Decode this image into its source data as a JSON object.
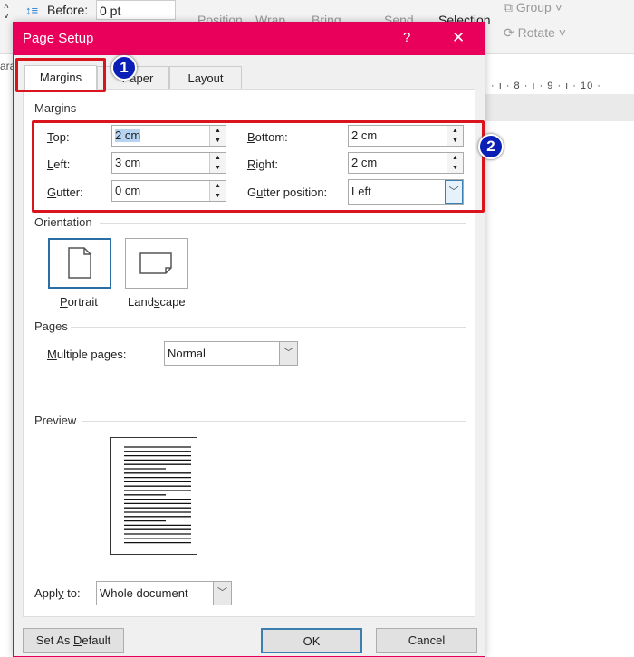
{
  "ribbon": {
    "before_label": "Before:",
    "before_value": "0 pt",
    "items": [
      "Position",
      "Wrap",
      "Bring",
      "Send",
      "Selection",
      "Group",
      "Rotate"
    ],
    "partial_label": "ara"
  },
  "ruler": {
    "ticks": "· ı · 8 · ı · 9 · ı · 10 ·"
  },
  "dialog": {
    "title": "Page Setup",
    "help": "?",
    "close": "✕",
    "accent": "#e8005a",
    "tabs": [
      {
        "label": "Margins",
        "active": true
      },
      {
        "label": "Paper"
      },
      {
        "label": "Layout"
      }
    ],
    "margins": {
      "heading": "Margins",
      "top": {
        "label": "Top:",
        "value": "2 cm"
      },
      "bottom": {
        "label": "Bottom:",
        "value": "2 cm"
      },
      "left": {
        "label": "Left:",
        "value": "3 cm"
      },
      "right": {
        "label": "Right:",
        "value": "2 cm"
      },
      "gutter": {
        "label": "Gutter:",
        "value": "0 cm"
      },
      "gutter_position": {
        "label": "Gutter position:",
        "value": "Left"
      }
    },
    "orientation": {
      "heading": "Orientation",
      "portrait": "Portrait",
      "landscape": "Landscape",
      "selected": "Portrait"
    },
    "pages": {
      "heading": "Pages",
      "multiple_label": "Multiple pages:",
      "multiple_value": "Normal"
    },
    "preview": {
      "heading": "Preview"
    },
    "apply": {
      "label": "Apply to:",
      "value": "Whole document"
    },
    "buttons": {
      "set_default": "Set As Default",
      "ok": "OK",
      "cancel": "Cancel"
    }
  },
  "annotations": {
    "step1": "1",
    "step2": "2",
    "highlight_color": "#d9141c",
    "badge_color": "#0a1fb5"
  }
}
